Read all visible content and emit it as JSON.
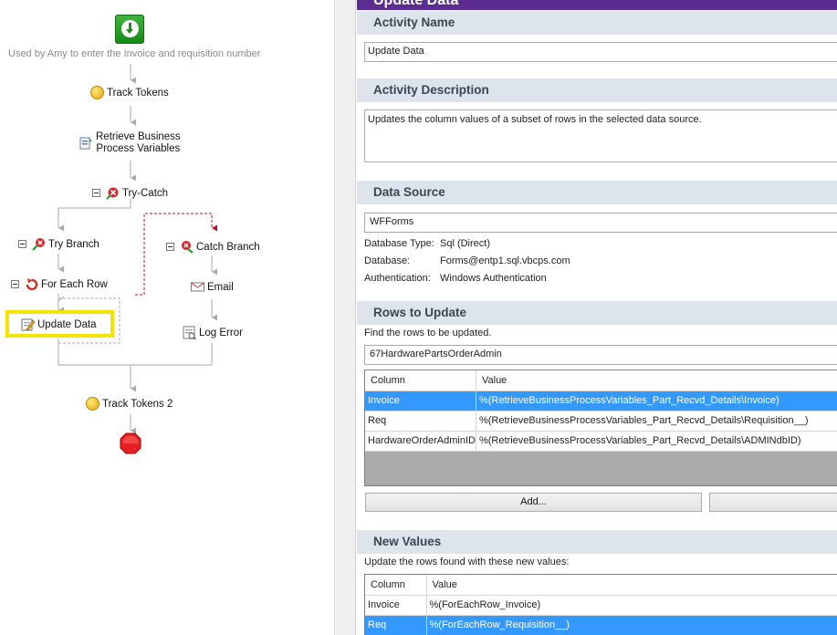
{
  "workflow": {
    "note": "Used by Amy to enter the Invoice and requisition number",
    "track_tokens": "Track Tokens",
    "retrieve_line1": "Retrieve Business",
    "retrieve_line2": "Process Variables",
    "try_catch": "Try-Catch",
    "try_branch": "Try Branch",
    "catch_branch": "Catch Branch",
    "for_each_row": "For Each Row",
    "email": "Email",
    "update_data": "Update Data",
    "log_error": "Log Error",
    "track_tokens_2": "Track Tokens 2"
  },
  "panel": {
    "title": "Update Data",
    "activity_name_header": "Activity Name",
    "activity_name_value": "Update Data",
    "activity_description_header": "Activity Description",
    "activity_description_value": "Updates the column values of a subset of rows in the selected data source.",
    "data_source_header": "Data Source",
    "data_source_value": "WFForms",
    "db_type_label": "Database Type:",
    "db_type_value": "Sql (Direct)",
    "database_label": "Database:",
    "database_value": "Forms@entp1.sql.vbcps.com",
    "auth_label": "Authentication:",
    "auth_value": "Windows Authentication",
    "rows_header": "Rows to Update",
    "rows_hint": "Find the rows to be updated.",
    "rows_table_value": "67HardwarePartsOrderAdmin",
    "rows_grid": {
      "columns": [
        "Column",
        "Value"
      ],
      "rows": [
        {
          "column": "Invoice",
          "value": "%(RetrieveBusinessProcessVariables_Part_Recvd_Details\\Invoice)"
        },
        {
          "column": "Req",
          "value": "%(RetrieveBusinessProcessVariables_Part_Recvd_Details\\Requisition__)"
        },
        {
          "column": "HardwareOrderAdminID",
          "value": "%(RetrieveBusinessProcessVariables_Part_Recvd_Details\\ADMINdbID)"
        }
      ],
      "selected_index": 0
    },
    "add_button": "Add...",
    "new_values_header": "New Values",
    "new_values_hint": "Update the rows found with these new values:",
    "values_grid": {
      "columns": [
        "Column",
        "Value"
      ],
      "rows": [
        {
          "column": "Invoice",
          "value": "%(ForEachRow_Invoice)"
        },
        {
          "column": "Req",
          "value": "%(ForEachRow_Requisition__)"
        }
      ],
      "selected_index": 1
    }
  },
  "colors": {
    "title_bar": "#5c2d91",
    "section_header": "#dde4ec",
    "selection": "#3399ff",
    "highlight_box": "#f5e400"
  }
}
